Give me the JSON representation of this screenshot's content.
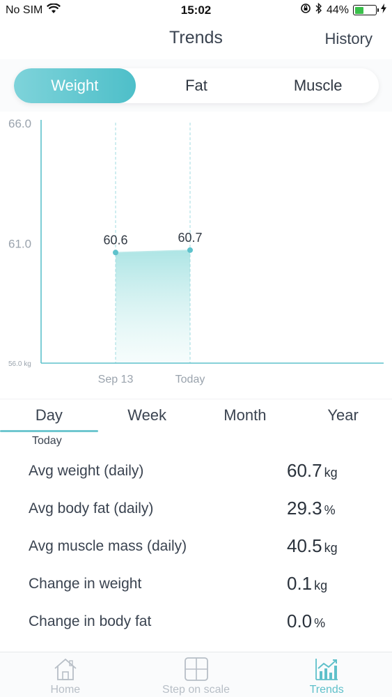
{
  "status_bar": {
    "carrier": "No SIM",
    "time": "15:02",
    "battery_percent": "44%",
    "battery_level": 0.44,
    "icons": [
      "wifi-icon",
      "orientation-lock-icon",
      "bluetooth-icon",
      "battery-icon",
      "charging-icon"
    ]
  },
  "nav": {
    "title": "Trends",
    "history": "History"
  },
  "metric_tabs": [
    "Weight",
    "Fat",
    "Muscle"
  ],
  "metric_tabs_active": "Weight",
  "chart_data": {
    "type": "area",
    "x": [
      "Sep 13",
      "Today"
    ],
    "series": [
      {
        "values": [
          60.6,
          60.7
        ]
      }
    ],
    "data_labels": [
      "60.6",
      "60.7"
    ],
    "y_ticks": [
      "66.0",
      "61.0",
      "56.0 kg"
    ],
    "ylim": [
      56.0,
      66.0
    ],
    "grid": false,
    "accent_color": "#5ec2cc"
  },
  "period_tabs": [
    "Day",
    "Week",
    "Month",
    "Year"
  ],
  "period_tabs_active": "Day",
  "period_caption": "Today",
  "stats": [
    {
      "label": "Avg weight (daily)",
      "value": "60.7",
      "unit": "kg"
    },
    {
      "label": "Avg body fat (daily)",
      "value": "29.3",
      "unit": "%"
    },
    {
      "label": "Avg muscle mass (daily)",
      "value": "40.5",
      "unit": "kg"
    },
    {
      "label": "Change in weight",
      "value": "0.1",
      "unit": "kg"
    },
    {
      "label": "Change in body fat",
      "value": "0.0",
      "unit": "%"
    }
  ],
  "tab_bar": [
    {
      "label": "Home",
      "icon": "home-icon"
    },
    {
      "label": "Step on scale",
      "icon": "scale-icon"
    },
    {
      "label": "Trends",
      "icon": "trends-icon"
    }
  ],
  "colors": {
    "accent": "#5ec2cc",
    "text": "#3a4350",
    "muted": "#9aa3ad"
  }
}
